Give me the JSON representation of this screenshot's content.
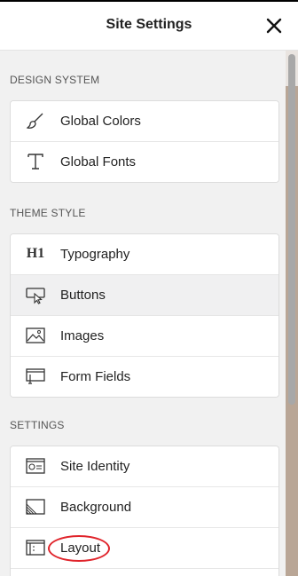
{
  "header": {
    "title": "Site Settings",
    "close_icon": "close-icon"
  },
  "sections": [
    {
      "title": "DESIGN SYSTEM",
      "items": [
        {
          "label": "Global Colors",
          "icon": "brush-icon"
        },
        {
          "label": "Global Fonts",
          "icon": "typeface-icon"
        }
      ]
    },
    {
      "title": "THEME STYLE",
      "items": [
        {
          "label": "Typography",
          "icon": "heading-icon",
          "icon_text": "H1"
        },
        {
          "label": "Buttons",
          "icon": "button-cursor-icon",
          "active": true
        },
        {
          "label": "Images",
          "icon": "image-icon"
        },
        {
          "label": "Form Fields",
          "icon": "form-field-icon"
        }
      ]
    },
    {
      "title": "SETTINGS",
      "items": [
        {
          "label": "Site Identity",
          "icon": "site-identity-icon"
        },
        {
          "label": "Background",
          "icon": "background-icon"
        },
        {
          "label": "Layout",
          "icon": "layout-icon",
          "highlighted": true
        }
      ]
    }
  ],
  "colors": {
    "highlight_ring": "#e0242b",
    "active_row": "#f0f0f1",
    "panel_bg": "#f1f1f1"
  }
}
